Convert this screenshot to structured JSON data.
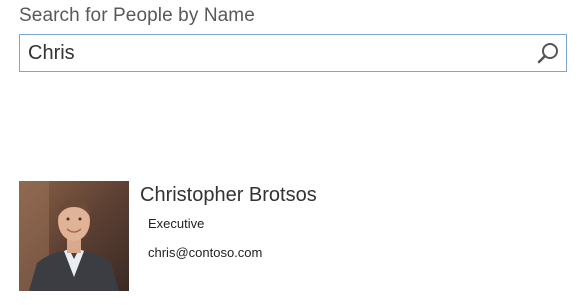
{
  "search": {
    "label": "Search for People by Name",
    "value": "Chris",
    "icon": "search-icon",
    "border_color": "#7aa7cf"
  },
  "results": [
    {
      "name": "Christopher Brotsos",
      "title": "Executive",
      "email": "chris@contoso.com"
    }
  ]
}
